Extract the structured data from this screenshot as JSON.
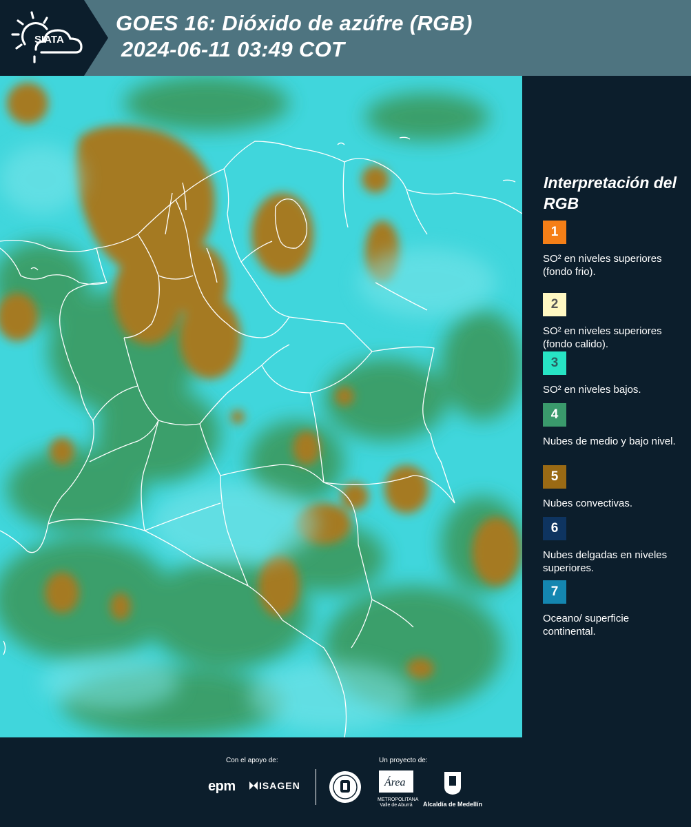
{
  "header": {
    "logo_text": "SIATA",
    "title_line1": "GOES 16: Dióxido de azúfre (RGB)",
    "title_line2": "2024-06-11 03:49 COT",
    "colors": {
      "logo_bg": "#0c1e2c",
      "banner_bg": "#4e7480"
    }
  },
  "legend": {
    "title": "Interpretación del RGB",
    "items": [
      {
        "number": "1",
        "color": "#f57f17",
        "number_color": "#ffffff",
        "description": "SO² en niveles superiores (fondo frio)."
      },
      {
        "number": "2",
        "color": "#fff8c2",
        "number_color": "#555555",
        "description": "SO² en niveles superiores (fondo calido)."
      },
      {
        "number": "3",
        "color": "#27e4c4",
        "number_color": "#2a6060",
        "description": "SO² en niveles bajos."
      },
      {
        "number": "4",
        "color": "#3a9a6c",
        "number_color": "#ffffff",
        "description": "Nubes de medio y bajo nivel."
      },
      {
        "number": "5",
        "color": "#9a6a14",
        "number_color": "#ffffff",
        "description": "Nubes convectivas."
      },
      {
        "number": "6",
        "color": "#0e3460",
        "number_color": "#ffffff",
        "description": "Nubes delgadas en niveles superiores."
      },
      {
        "number": "7",
        "color": "#1486b0",
        "number_color": "#ffffff",
        "description": "Oceano/ superficie continental."
      }
    ]
  },
  "footer": {
    "support_caption": "Con el apoyo de:",
    "project_caption": "Un proyecto de:",
    "sponsors": [
      "epm",
      "ISAGEN"
    ],
    "partners": [
      "Área Metropolitana Valle de Aburrá",
      "Alcaldía de Medellín"
    ],
    "area_logo_word": "Área",
    "area_logo_line1": "METROPOLITANA",
    "area_logo_line2": "Valle de Aburrá",
    "alcaldia_label": "Alcaldía de Medellín"
  },
  "map": {
    "imagery_colors": {
      "cyan": "#40d6dc",
      "green": "#3b9a5f",
      "brown": "#a57a22",
      "border": "#ffffff"
    }
  }
}
